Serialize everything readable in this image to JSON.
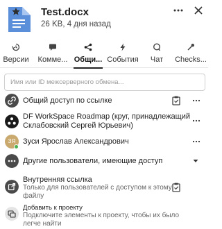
{
  "header": {
    "file_name": "Test.docx",
    "file_meta": "26 KB, 4 дня назад"
  },
  "tabs": [
    {
      "label": "Версии",
      "icon": "history-icon",
      "active": false
    },
    {
      "label": "Комме...",
      "icon": "comment-icon",
      "active": false
    },
    {
      "label": "Общи...",
      "icon": "share-icon",
      "active": true
    },
    {
      "label": "События",
      "icon": "activity-icon",
      "active": false
    },
    {
      "label": "Чат",
      "icon": "chat-icon",
      "active": false
    },
    {
      "label": "Checks...",
      "icon": "checks-icon",
      "active": false
    }
  ],
  "search": {
    "placeholder": "Имя или ID межсерверного обмена..."
  },
  "shares": {
    "public_link": {
      "label": "Общий доступ по ссылке"
    },
    "roadmap": {
      "label_line1": "DF WorkSpace Roadmap (круг, принадлежащий",
      "label_line2": "Склабовский Сергей Юрьевич)"
    },
    "user": {
      "initials": "ЗЯ",
      "name": "Зуси Ярослав Александрович"
    },
    "others": {
      "label": "Другие пользователи, имеющие доступ"
    },
    "internal_link": {
      "title": "Внутренняя ссылка",
      "desc_line1": "Только для пользователей с доступом к этому",
      "desc_line2": "файлу"
    },
    "add_project": {
      "title": "Добавить к проекту",
      "desc_line1": "Подключите элементы к проекту, чтобы их было",
      "desc_line2": "легче найти"
    }
  },
  "colors": {
    "link_avatar": "#4a4a4a",
    "user_avatar": "#c9a96e",
    "file_icon": "#5b8fd9",
    "active_tab": "#222222"
  }
}
